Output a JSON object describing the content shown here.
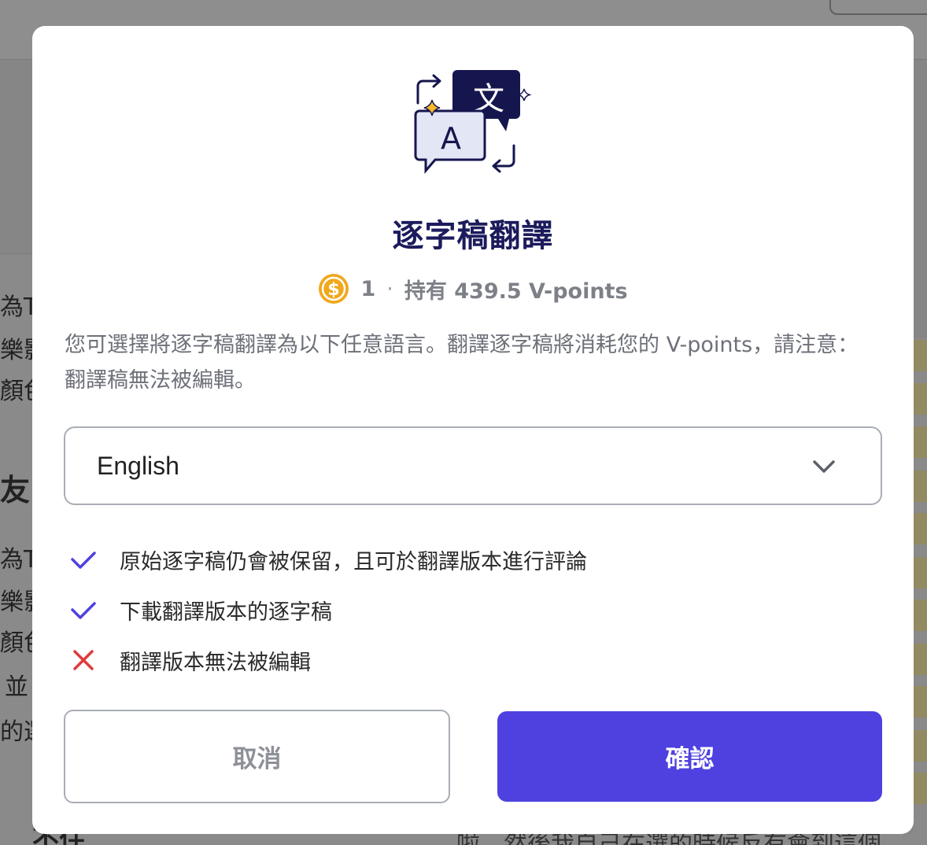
{
  "background": {
    "left_lines": [
      "為TC",
      "樂影",
      "顏色",
      "友",
      "為TC",
      "樂影",
      "顏色",
      "並",
      "的選"
    ],
    "bottom_left_text": "不住",
    "bottom_right_text": "啦，然後我自己在選的時候反有會到這個"
  },
  "dialog": {
    "title": "逐字稿翻譯",
    "cost": {
      "amount": "1",
      "separator": "·",
      "balance": "持有 439.5 V-points"
    },
    "description": "您可選擇將逐字稿翻譯為以下任意語言。翻譯逐字稿將消耗您的 V-points，請注意：翻譯稿無法被編輯。",
    "language_select": {
      "selected": "English"
    },
    "features": [
      {
        "icon": "check-icon",
        "status": "yes",
        "text": "原始逐字稿仍會被保留，且可於翻譯版本進行評論"
      },
      {
        "icon": "check-icon",
        "status": "yes",
        "text": "下載翻譯版本的逐字稿"
      },
      {
        "icon": "cross-icon",
        "status": "no",
        "text": "翻譯版本無法被編輯"
      }
    ],
    "buttons": {
      "cancel": "取消",
      "confirm": "確認"
    }
  },
  "colors": {
    "accent": "#4e41e0",
    "title": "#1b1b5c",
    "check": "#4e41e0",
    "cross": "#e03a3a",
    "coin": "#f0a81c"
  }
}
